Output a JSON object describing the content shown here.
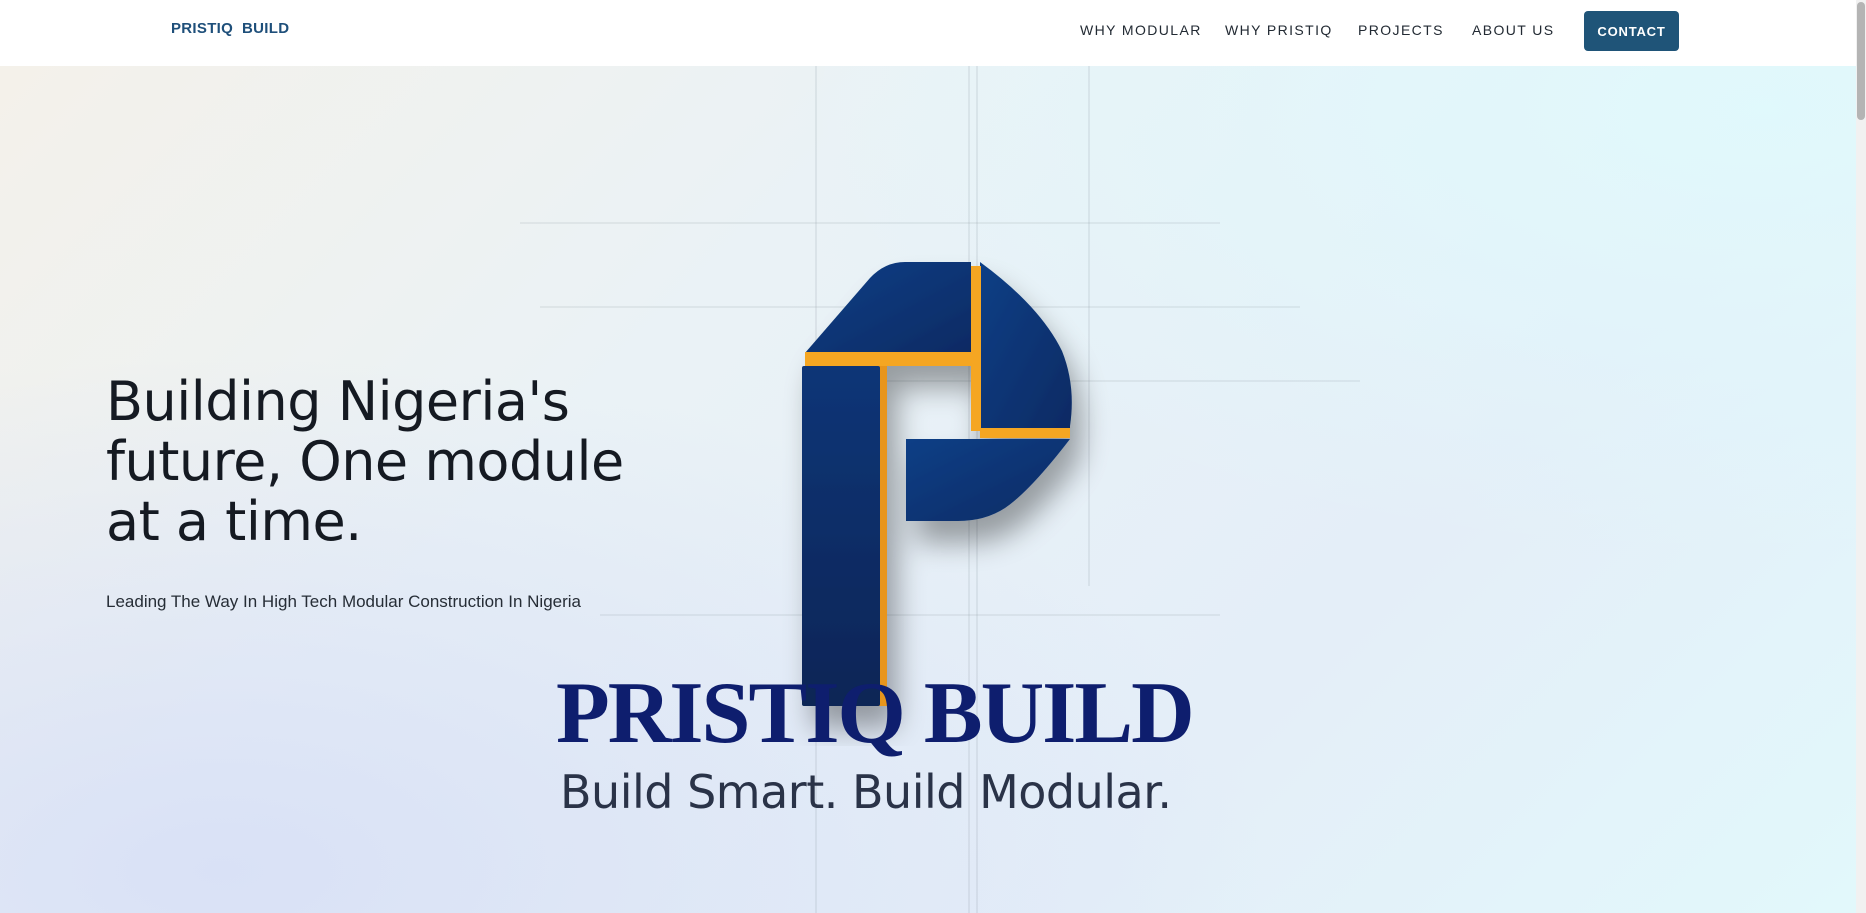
{
  "nav": {
    "brand": "PRISTIQ  BUILD",
    "links": [
      "WHY MODULAR",
      "WHY PRISTIQ",
      "PROJECTS",
      "ABOUT US"
    ],
    "contact_label": "CONTACT"
  },
  "hero": {
    "headline": "Building Nigeria's future, One module at a time.",
    "tagline": "Leading The Way In High Tech Modular Construction In Nigeria",
    "logo_wordmark": "PRISTIQ BUILD",
    "logo_slogan": "Build Smart. Build Modular."
  },
  "colors": {
    "brand_blue": "#1e4f7a",
    "contact_button": "#1f5478",
    "logo_navy": "#0e1e6e",
    "logo_accent_orange": "#f5a623"
  }
}
